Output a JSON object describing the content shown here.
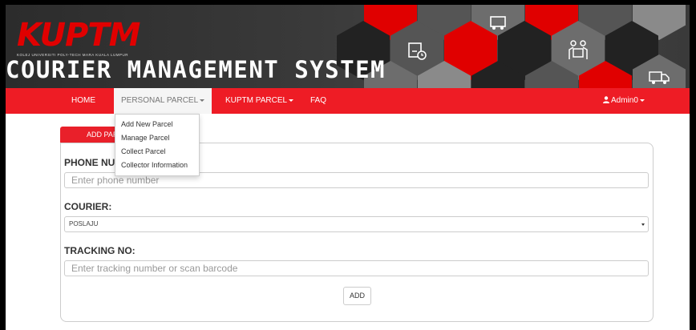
{
  "header": {
    "logo_text": "KUPTM",
    "logo_subtitle": "KOLEJ UNIVERSITI POLY-TECH MARA KUALA LUMPUR",
    "system_title": "COURIER MANAGEMENT SYSTEM",
    "icons": [
      "parcel-clock-icon",
      "truck-icon",
      "people-with-parcel-icon",
      "delivery-truck-icon"
    ]
  },
  "nav": {
    "home": "HOME",
    "personal_parcel": "PERSONAL PARCEL",
    "kuptm_parcel": "KUPTM PARCEL",
    "faq": "FAQ",
    "user": "Admin0"
  },
  "dropdown": {
    "items": [
      "Add New Parcel",
      "Manage Parcel",
      "Collect Parcel",
      "Collector Information"
    ]
  },
  "form": {
    "tab_label": "ADD PARCEL",
    "phone_label": "PHONE NUMBER:",
    "phone_placeholder": "Enter phone number",
    "courier_label": "COURIER:",
    "courier_value": "POSLAJU",
    "tracking_label": "TRACKING NO:",
    "tracking_placeholder": "Enter tracking number or scan barcode",
    "add_button": "ADD"
  },
  "colors": {
    "accent_red": "#ee1c25",
    "banner_dark": "#3b3b3b"
  }
}
